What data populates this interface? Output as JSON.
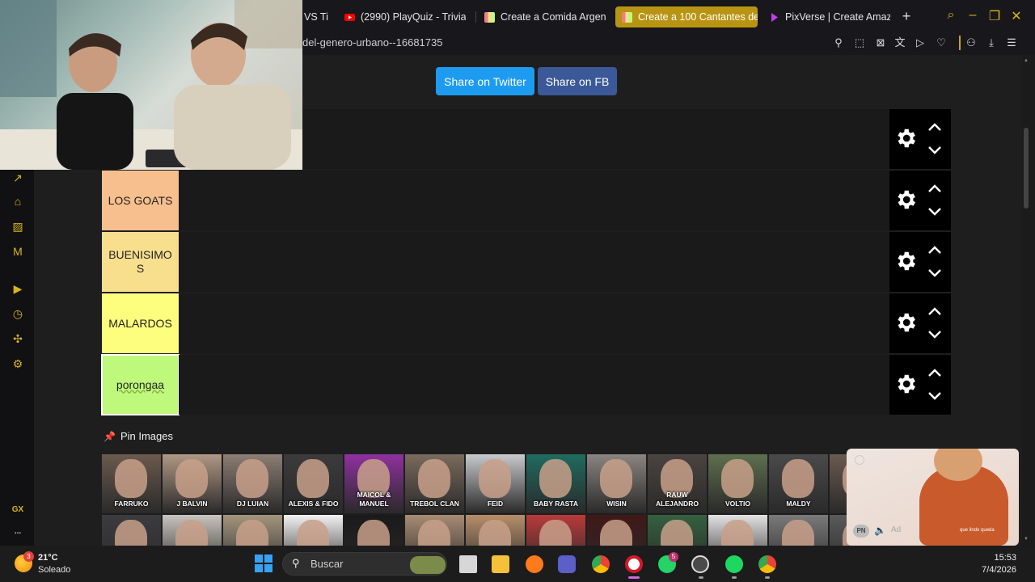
{
  "browser": {
    "tabs": [
      {
        "label": "VS Ti",
        "favicon_color": "#8a8a8a"
      },
      {
        "label": "(2990) PlayQuiz - Trivia",
        "favicon_color": "#ff0000"
      },
      {
        "label": "Create a Comida Argenti",
        "favicon_color": "#e9c46a"
      },
      {
        "label": "Create a 100 Cantantes de",
        "favicon_color": "#e9c46a"
      },
      {
        "label": "PixVerse | Create Amazin",
        "favicon_color": "#c23cf0"
      }
    ],
    "new_tab_symbol": "+",
    "url": "del-genero-urbano--16681735",
    "accent_color": "#b89412"
  },
  "share": {
    "twitter_label": "Share on Twitter",
    "facebook_label": "Share on FB"
  },
  "tiers": [
    {
      "label": "",
      "color": "#f08080"
    },
    {
      "label": "LOS GOATS",
      "color": "#f7bf8d"
    },
    {
      "label": "BUENISIMOS",
      "color": "#f7df8d"
    },
    {
      "label": "MALARDOS",
      "color": "#fdfd7e"
    },
    {
      "label": "porongaa",
      "color": "#bff97c"
    }
  ],
  "pin_images": {
    "title": "Pin Images",
    "row1": [
      {
        "caption": "FARRUKO",
        "tone": "#6b5a4e"
      },
      {
        "caption": "J BALVIN",
        "tone": "#b09885"
      },
      {
        "caption": "DJ LUIAN",
        "tone": "#8c7e74"
      },
      {
        "caption": "ALEXIS & FIDO",
        "tone": "#3b3b3b"
      },
      {
        "caption": "MAICOL & MANUEL",
        "tone": "#9030a0"
      },
      {
        "caption": "TREBOL CLAN",
        "tone": "#7a6b5d"
      },
      {
        "caption": "FEID",
        "tone": "#c7c9cc"
      },
      {
        "caption": "BABY RASTA",
        "tone": "#1f6b60"
      },
      {
        "caption": "WISIN",
        "tone": "#8a8580"
      },
      {
        "caption": "RAUW ALEJANDRO",
        "tone": "#4a4440"
      },
      {
        "caption": "VOLTIO",
        "tone": "#5e6f4e"
      },
      {
        "caption": "MALDY",
        "tone": "#4a4a4a"
      },
      {
        "caption": "",
        "tone": "#6a5a50"
      }
    ],
    "row2": [
      {
        "caption": "",
        "tone": "#3c3c40"
      },
      {
        "caption": "",
        "tone": "#c9c4bf"
      },
      {
        "caption": "",
        "tone": "#a4967d"
      },
      {
        "caption": "",
        "tone": "#f2f2f2"
      },
      {
        "caption": "",
        "tone": "#1a1a1a"
      },
      {
        "caption": "",
        "tone": "#a88c74"
      },
      {
        "caption": "",
        "tone": "#b68e6a"
      },
      {
        "caption": "",
        "tone": "#b83a3a"
      },
      {
        "caption": "",
        "tone": "#401818"
      },
      {
        "caption": "",
        "tone": "#356040"
      },
      {
        "caption": "",
        "tone": "#e2e2e2"
      },
      {
        "caption": "",
        "tone": "#7a7a7a"
      },
      {
        "caption": "",
        "tone": "#5a5a5a"
      }
    ]
  },
  "sidebar": {
    "gx_label": "GX",
    "more_label": "..."
  },
  "ad": {
    "badge": "PN",
    "label": "Ad",
    "caption": "que lindo queda"
  },
  "taskbar": {
    "weather_temp": "21°C",
    "weather_cond": "Soleado",
    "weather_badge": "3",
    "search_placeholder": "Buscar",
    "whatsapp_badge": "5",
    "time": "15:53",
    "date": "7/4/2026"
  }
}
